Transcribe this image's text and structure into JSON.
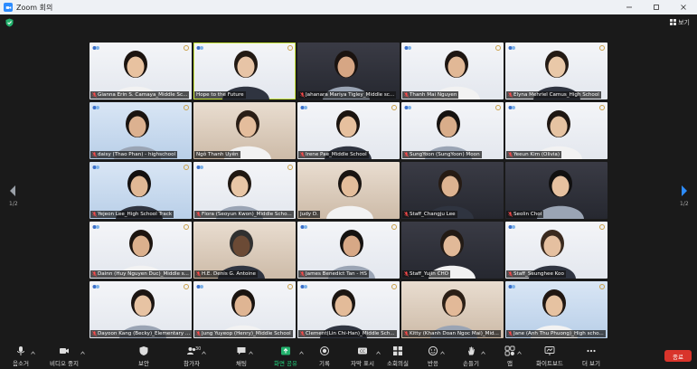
{
  "window": {
    "title": "Zoom 회의"
  },
  "header": {
    "view_label": "보기"
  },
  "nav": {
    "page_left": "1/2",
    "page_right": "1/2"
  },
  "tiles": [
    {
      "name": "Gianna Erin S. Camaya_Middle Sc...",
      "muted": true
    },
    {
      "name": "Hope to the Future",
      "muted": false,
      "active": true
    },
    {
      "name": "Jahanara Mariya Tigley_Middle sc...",
      "muted": true
    },
    {
      "name": "Thanh Mai Nguyen",
      "muted": true
    },
    {
      "name": "Elyna Mehriel Camus_High School",
      "muted": true
    },
    {
      "name": "daisy (Thao Phan) - highschool",
      "muted": true
    },
    {
      "name": "Ngô Thanh Uyên",
      "muted": false
    },
    {
      "name": "Irene Pae_Middle School",
      "muted": true
    },
    {
      "name": "SungYoon (SungYoon) Moon",
      "muted": true
    },
    {
      "name": "Yeeun Kim (Olivia)",
      "muted": true
    },
    {
      "name": "Yejeon Lee_High School Track",
      "muted": true
    },
    {
      "name": "Flora (Seoyun Kwon)_Middle Scho...",
      "muted": true
    },
    {
      "name": "Judy D.",
      "muted": false
    },
    {
      "name": "Staff_Changju Lee",
      "muted": true
    },
    {
      "name": "Seolin Choi",
      "muted": true
    },
    {
      "name": "Dainn (Huy Nguyen Duc)_Middle s...",
      "muted": true
    },
    {
      "name": "H.E. Denis G. Antoine",
      "muted": true
    },
    {
      "name": "James Benedict Tan - HS",
      "muted": true
    },
    {
      "name": "Staff_Yujin CHO",
      "muted": true
    },
    {
      "name": "Staff_Seunghee Koo",
      "muted": true
    },
    {
      "name": "Dayoon Kang (Becky)_Elementary ...",
      "muted": true
    },
    {
      "name": "Jung Yuyeop (Henry)_Middle School",
      "muted": true
    },
    {
      "name": "Clement(Lin Chi-Han)_Middle Sch...",
      "muted": true
    },
    {
      "name": "Kitty (Khanh Doan Ngoc Mai)_Mid...",
      "muted": true
    },
    {
      "name": "Jane (Anh Thu Phuong)_High scho...",
      "muted": true
    }
  ],
  "toolbar": {
    "audio": "음소거",
    "video": "비디오 중지",
    "security": "보안",
    "participants": "참가자",
    "participants_count": "30",
    "chat": "채팅",
    "share": "화면 공유",
    "record": "기록",
    "captions": "자막 표시",
    "breakout": "소회의실",
    "reactions": "반응",
    "raise_hand": "손들기",
    "apps": "앱",
    "whiteboard": "화이트보드",
    "more": "더 보기",
    "end": "종료"
  }
}
